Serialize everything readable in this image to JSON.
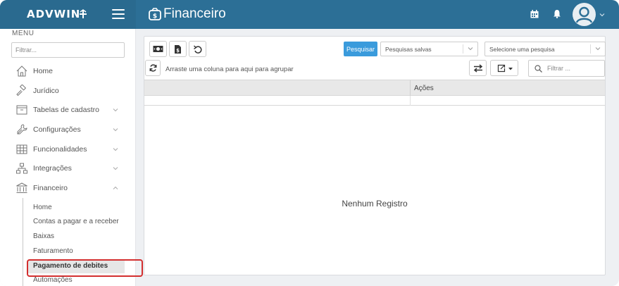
{
  "header": {
    "logo": "ADVWIN",
    "page_title": "Financeiro"
  },
  "sidebar": {
    "menu_label": "MENU",
    "filter_placeholder": "Filtrar...",
    "items": [
      {
        "label": "Home",
        "icon": "home-icon"
      },
      {
        "label": "Jurídico",
        "icon": "gavel-icon"
      },
      {
        "label": "Tabelas de cadastro",
        "icon": "archive-icon"
      },
      {
        "label": "Configurações",
        "icon": "wrench-icon"
      },
      {
        "label": "Funcionalidades",
        "icon": "grid-icon"
      },
      {
        "label": "Integrações",
        "icon": "network-icon"
      },
      {
        "label": "Financeiro",
        "icon": "bank-icon"
      }
    ],
    "sub_items": [
      {
        "label": "Home"
      },
      {
        "label": "Contas a pagar e a receber"
      },
      {
        "label": "Baixas"
      },
      {
        "label": "Faturamento"
      },
      {
        "label": "Pagamento de debites"
      },
      {
        "label": "Automações"
      }
    ]
  },
  "toolbar": {
    "search_button": "Pesquisar",
    "saved_searches": "Pesquisas salvas",
    "select_search": "Selecione uma pesquisa",
    "group_hint": "Arraste uma coluna para aqui para agrupar",
    "grid_filter_placeholder": "Filtrar ..."
  },
  "grid": {
    "columns": [
      "",
      "Ações"
    ],
    "empty_message": "Nenhum Registro"
  },
  "colors": {
    "topbar": "#2c6f96",
    "accent": "#3a9bdc",
    "highlight": "#d32f2f"
  }
}
